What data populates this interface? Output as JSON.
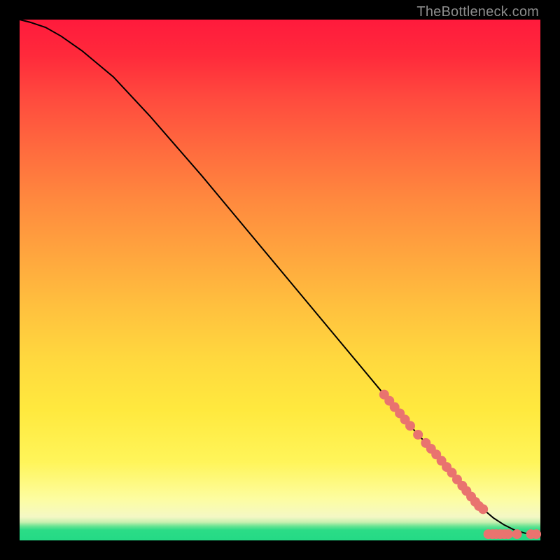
{
  "watermark": "TheBottleneck.com",
  "chart_data": {
    "type": "line",
    "title": "",
    "xlabel": "",
    "ylabel": "",
    "xlim": [
      0,
      100
    ],
    "ylim": [
      0,
      100
    ],
    "grid": false,
    "series": [
      {
        "name": "curve",
        "stroke": "#000000",
        "x": [
          0,
          2,
          5,
          8,
          12,
          18,
          25,
          35,
          45,
          55,
          65,
          70,
          75,
          80,
          83,
          85,
          87,
          89,
          91,
          93,
          95,
          97,
          99,
          100
        ],
        "y": [
          100,
          99.5,
          98.5,
          96.8,
          94.0,
          89.0,
          81.5,
          70.0,
          58.0,
          46.0,
          34.0,
          28.0,
          22.0,
          16.5,
          13.0,
          10.5,
          8.0,
          6.0,
          4.3,
          3.0,
          2.0,
          1.4,
          1.1,
          1.0
        ]
      }
    ],
    "markers": {
      "name": "highlight-dots",
      "color": "#e9736f",
      "radius": 7,
      "points": [
        {
          "x": 70.0,
          "y": 28.0
        },
        {
          "x": 71.0,
          "y": 26.8
        },
        {
          "x": 72.0,
          "y": 25.6
        },
        {
          "x": 73.0,
          "y": 24.4
        },
        {
          "x": 74.0,
          "y": 23.2
        },
        {
          "x": 75.0,
          "y": 22.0
        },
        {
          "x": 76.5,
          "y": 20.3
        },
        {
          "x": 78.0,
          "y": 18.7
        },
        {
          "x": 79.0,
          "y": 17.6
        },
        {
          "x": 80.0,
          "y": 16.5
        },
        {
          "x": 81.0,
          "y": 15.3
        },
        {
          "x": 82.0,
          "y": 14.1
        },
        {
          "x": 83.0,
          "y": 13.0
        },
        {
          "x": 84.0,
          "y": 11.7
        },
        {
          "x": 85.0,
          "y": 10.5
        },
        {
          "x": 85.8,
          "y": 9.5
        },
        {
          "x": 86.7,
          "y": 8.4
        },
        {
          "x": 87.5,
          "y": 7.4
        },
        {
          "x": 88.2,
          "y": 6.6
        },
        {
          "x": 89.0,
          "y": 6.0
        },
        {
          "x": 90.0,
          "y": 1.2
        },
        {
          "x": 90.8,
          "y": 1.2
        },
        {
          "x": 91.5,
          "y": 1.2
        },
        {
          "x": 92.3,
          "y": 1.2
        },
        {
          "x": 93.1,
          "y": 1.2
        },
        {
          "x": 93.8,
          "y": 1.2
        },
        {
          "x": 95.5,
          "y": 1.2
        },
        {
          "x": 98.2,
          "y": 1.2
        },
        {
          "x": 99.2,
          "y": 1.2
        }
      ]
    },
    "background_gradient": {
      "direction": "vertical",
      "stops": [
        {
          "pos": 0.0,
          "color": "#ff1a3c"
        },
        {
          "pos": 0.45,
          "color": "#ffa53e"
        },
        {
          "pos": 0.85,
          "color": "#fff55a"
        },
        {
          "pos": 0.97,
          "color": "#66e392"
        },
        {
          "pos": 1.0,
          "color": "#24da85"
        }
      ]
    }
  }
}
